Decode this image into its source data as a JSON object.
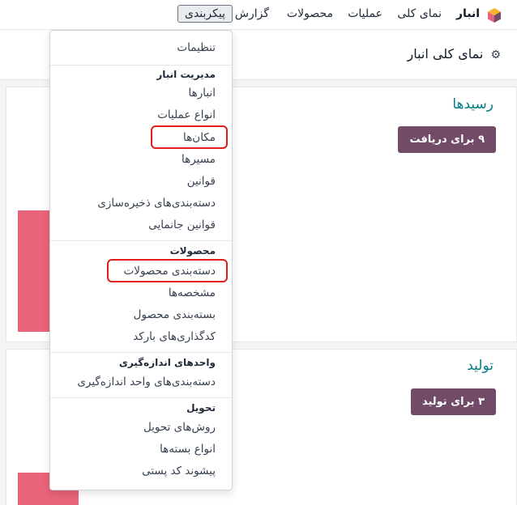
{
  "navbar": {
    "app_name": "انبار",
    "items": [
      "نمای کلی",
      "عملیات",
      "محصولات",
      "گزارش",
      "پیکربندی"
    ],
    "active": "پیکربندی"
  },
  "breadcrumb": {
    "title": "نمای کلی انبار"
  },
  "cards": [
    {
      "title": "رسیدها",
      "button": "۹ برای دریافت"
    },
    {
      "title": "تولید",
      "button": "۳ برای تولید"
    }
  ],
  "dropdown": {
    "settings": "تنظیمات",
    "sections": [
      {
        "header": "مدیریت انبار",
        "items": [
          "انبارها",
          "انواع عملیات",
          "مکان‌ها",
          "مسیرها",
          "قوانین",
          "دسته‌بندی‌های ذخیره‌سازی",
          "قوانین جانمایی"
        ]
      },
      {
        "header": "محصولات",
        "items": [
          "دسته‌بندی محصولات",
          "مشخصه‌ها",
          "بسته‌بندی محصول",
          "کدگذاری‌های بارکد"
        ]
      },
      {
        "header": "واحدهای اندازه‌گیری",
        "items": [
          "دسته‌بندی‌های واحد اندازه‌گیری"
        ]
      },
      {
        "header": "تحویل",
        "items": [
          "روش‌های تحویل",
          "انواع بسته‌ها",
          "پیشوند کد پستی"
        ]
      }
    ]
  },
  "colors": {
    "brand": "#714b67",
    "accent": "#017e84",
    "bar": "#e8647a",
    "highlight": "#e31c1c"
  }
}
